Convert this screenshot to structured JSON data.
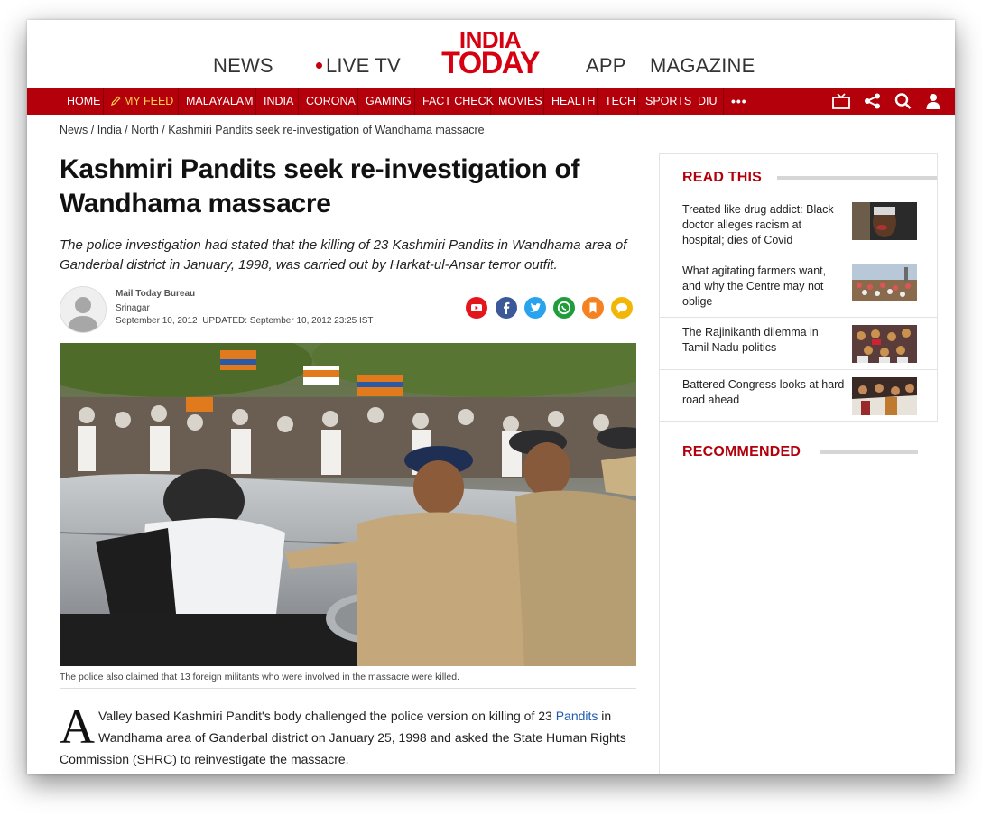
{
  "header": {
    "nav_left": [
      "NEWS",
      "LIVE TV"
    ],
    "logo_line1": "INDIA",
    "logo_line2": "TODAY",
    "nav_right": [
      "APP",
      "MAGAZINE"
    ]
  },
  "rednav": {
    "items": [
      "HOME",
      "MY FEED",
      "MALAYALAM",
      "INDIA",
      "CORONA",
      "GAMING",
      "FACT CHECK",
      "MOVIES",
      "HEALTH",
      "TECH",
      "SPORTS",
      "DIU"
    ],
    "more": "•••",
    "icons": [
      "tv-icon",
      "share-icon",
      "search-icon",
      "user-icon"
    ]
  },
  "breadcrumb": [
    "News",
    "India",
    "North",
    "Kashmiri Pandits seek re-investigation of Wandhama massacre"
  ],
  "article": {
    "title": "Kashmiri Pandits seek re-investigation of Wandhama massacre",
    "subtitle": "The police investigation had stated that the killing of 23 Kashmiri Pandits in Wandhama area of Ganderbal district in January, 1998, was carried out by Harkat-ul-Ansar terror outfit.",
    "author": "Mail Today Bureau",
    "location": "Srinagar",
    "date": "September 10, 2012",
    "updated": "UPDATED: September 10, 2012 23:25 IST",
    "share_icons": [
      "youtube-icon",
      "facebook-icon",
      "twitter-icon",
      "whatsapp-icon",
      "bookmark-icon",
      "comment-icon"
    ],
    "image_caption": "The police also claimed that 13 foreign militants who were involved in the massacre were killed.",
    "dropcap": "A",
    "body_before_link": "Valley based Kashmiri Pandit's body challenged the police version on killing of 23 ",
    "body_link": "Pandits",
    "body_after_link": " in Wandhama area of Ganderbal district on January 25, 1998 and asked the State Human Rights Commission (SHRC) to reinvestigate the massacre."
  },
  "sidebar": {
    "read_this_title": "READ THIS",
    "stories": [
      "Treated like drug addict: Black doctor alleges racism at hospital; dies of Covid",
      "What agitating farmers want, and why the Centre may not oblige",
      "The Rajinikanth dilemma in Tamil Nadu politics",
      "Battered Congress looks at hard road ahead"
    ],
    "recommended_title": "RECOMMENDED"
  },
  "colors": {
    "brand_red": "#b3000b",
    "logo_red": "#d60010",
    "myfeed_yellow": "#ffd24a",
    "link_blue": "#1c5bb1"
  }
}
